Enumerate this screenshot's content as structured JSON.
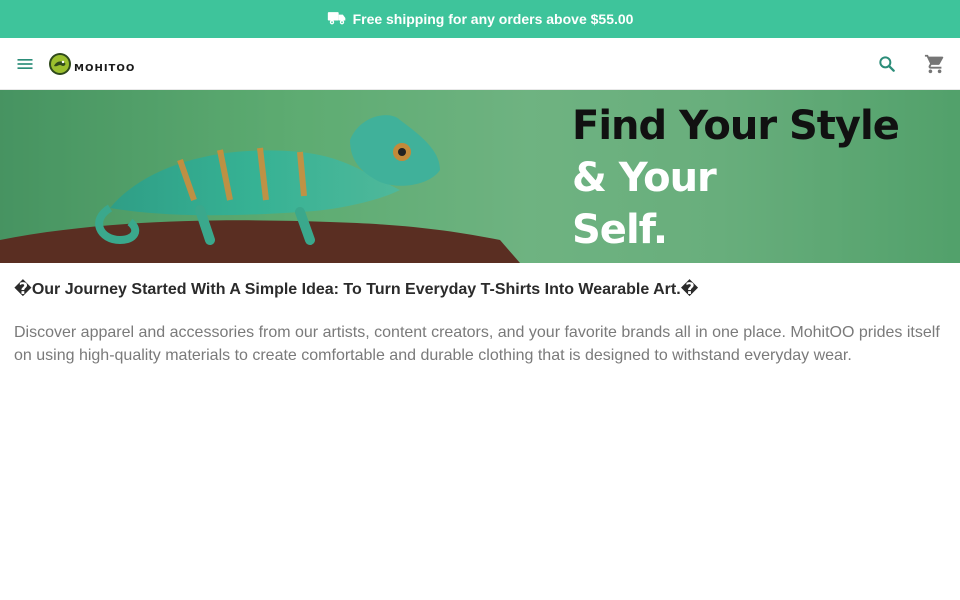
{
  "promo": {
    "text": "Free shipping for any orders above $55.00",
    "icon": "truck-icon"
  },
  "header": {
    "logo_text": "MOHITOO",
    "icons": {
      "menu": "menu-icon",
      "search": "search-icon",
      "cart": "cart-icon"
    },
    "accent_color": "#3ec49b"
  },
  "hero": {
    "line1": "Find Your Style",
    "line2": "& Your",
    "line3": "Self."
  },
  "content": {
    "headline": "�Our Journey Started With A Simple Idea: To Turn Everyday T-Shirts Into Wearable Art.�",
    "description": "Discover apparel and accessories from our artists, content creators, and your favorite brands all in one place. MohitOO prides itself on using high-quality materials to create comfortable and durable clothing that is designed to withstand everyday wear."
  }
}
